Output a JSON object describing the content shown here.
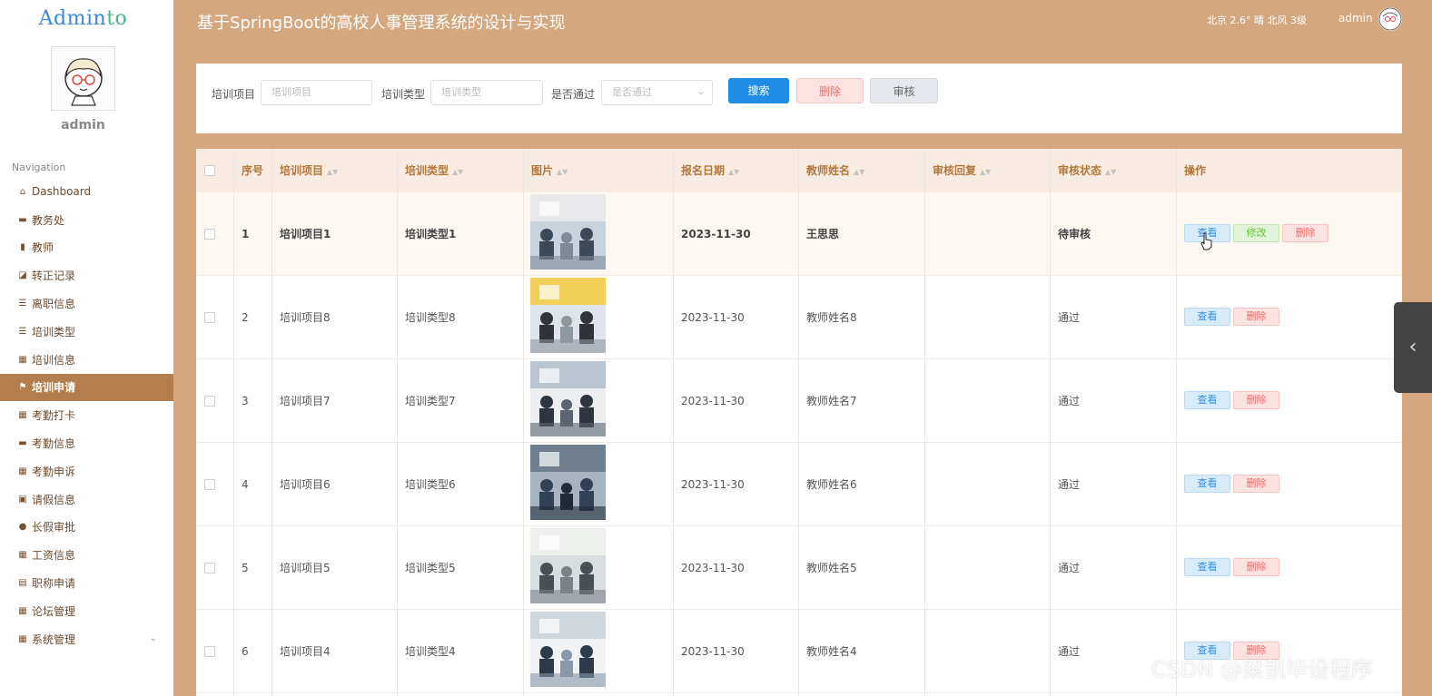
{
  "brand": {
    "part1": "Admin",
    "part2": "to"
  },
  "user": {
    "name": "admin"
  },
  "nav": {
    "title": "Navigation",
    "items": [
      {
        "label": "Dashboard",
        "icon": "home-icon"
      },
      {
        "label": "教务处",
        "icon": "monitor-icon"
      },
      {
        "label": "教师",
        "icon": "bar-chart-icon"
      },
      {
        "label": "转正记录",
        "icon": "line-chart-icon"
      },
      {
        "label": "离职信息",
        "icon": "list-icon"
      },
      {
        "label": "培训类型",
        "icon": "list-icon"
      },
      {
        "label": "培训信息",
        "icon": "grid-icon"
      },
      {
        "label": "培训申请",
        "icon": "flag-icon",
        "active": true
      },
      {
        "label": "考勤打卡",
        "icon": "grid-icon"
      },
      {
        "label": "考勤信息",
        "icon": "monitor-icon"
      },
      {
        "label": "考勤申诉",
        "icon": "grid-icon"
      },
      {
        "label": "请假信息",
        "icon": "clipboard-icon"
      },
      {
        "label": "长假审批",
        "icon": "user-icon"
      },
      {
        "label": "工资信息",
        "icon": "table-icon"
      },
      {
        "label": "职称申请",
        "icon": "briefcase-icon"
      },
      {
        "label": "论坛管理",
        "icon": "grid-icon"
      },
      {
        "label": "系统管理",
        "icon": "grid-icon"
      }
    ]
  },
  "header": {
    "title": "基于SpringBoot的高校人事管理系统的设计与实现",
    "weather": "北京  2.6°  晴  北风  3级",
    "user": "admin"
  },
  "search": {
    "project_label": "培训项目",
    "project_placeholder": "培训项目",
    "type_label": "培训类型",
    "type_placeholder": "培训类型",
    "pass_label": "是否通过",
    "pass_placeholder": "是否通过",
    "search_btn": "搜索",
    "delete_btn": "删除",
    "audit_btn": "审核"
  },
  "table": {
    "headers": [
      "序号",
      "培训项目",
      "培训类型",
      "图片",
      "报名日期",
      "教师姓名",
      "审核回复",
      "审核状态",
      "操作"
    ],
    "rows": [
      {
        "no": "1",
        "project": "培训项目1",
        "type": "培训类型1",
        "date": "2023-11-30",
        "teacher": "王思思",
        "reply": "",
        "status": "待审核",
        "ops": [
          "查看",
          "修改",
          "删除"
        ]
      },
      {
        "no": "2",
        "project": "培训项目8",
        "type": "培训类型8",
        "date": "2023-11-30",
        "teacher": "教师姓名8",
        "reply": "",
        "status": "通过",
        "ops": [
          "查看",
          "删除"
        ]
      },
      {
        "no": "3",
        "project": "培训项目7",
        "type": "培训类型7",
        "date": "2023-11-30",
        "teacher": "教师姓名7",
        "reply": "",
        "status": "通过",
        "ops": [
          "查看",
          "删除"
        ]
      },
      {
        "no": "4",
        "project": "培训项目6",
        "type": "培训类型6",
        "date": "2023-11-30",
        "teacher": "教师姓名6",
        "reply": "",
        "status": "通过",
        "ops": [
          "查看",
          "删除"
        ]
      },
      {
        "no": "5",
        "project": "培训项目5",
        "type": "培训类型5",
        "date": "2023-11-30",
        "teacher": "教师姓名5",
        "reply": "",
        "status": "通过",
        "ops": [
          "查看",
          "删除"
        ]
      },
      {
        "no": "6",
        "project": "培训项目4",
        "type": "培训类型4",
        "date": "2023-11-30",
        "teacher": "教师姓名4",
        "reply": "",
        "status": "通过",
        "ops": [
          "查看",
          "删除"
        ]
      }
    ]
  },
  "watermark": "CSDN @梁凯毕设程序",
  "colors": {
    "sidebar_active": "#b37d4d",
    "background": "#d5a77f",
    "primary": "#1f8ce6",
    "header_text": "#b3783c"
  }
}
